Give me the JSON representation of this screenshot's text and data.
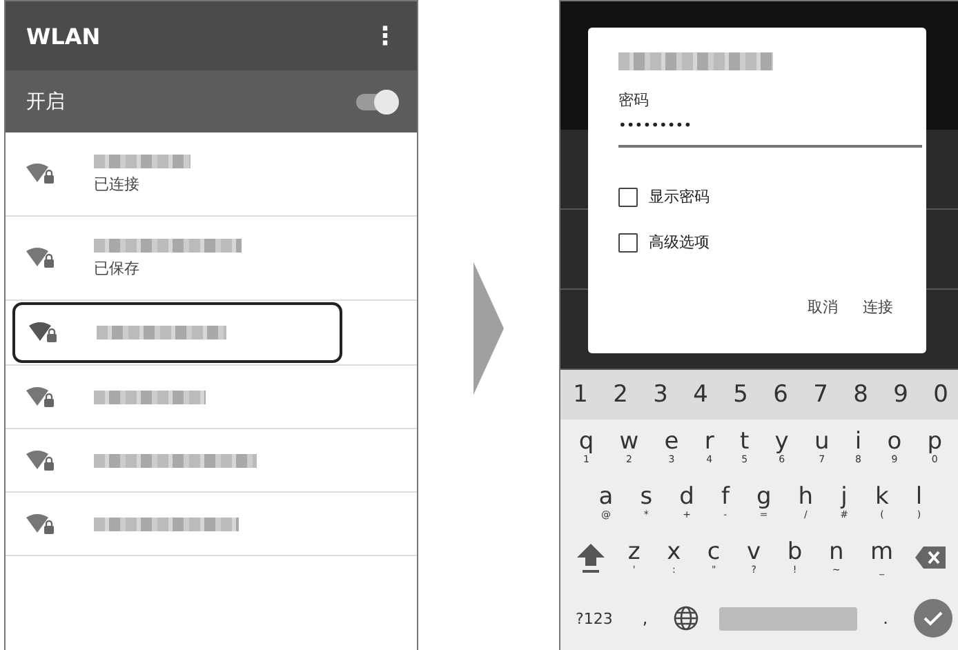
{
  "wlan_screen": {
    "title": "WLAN",
    "menu_icon": "⋮",
    "toggle": {
      "label": "开启",
      "on": true
    },
    "networks": [
      {
        "status": "已连接",
        "selected": false
      },
      {
        "status": "已保存",
        "selected": false
      },
      {
        "selected": true
      },
      {
        "selected": false
      },
      {
        "selected": false
      },
      {
        "selected": false
      }
    ]
  },
  "password_dialog": {
    "field_label": "密码",
    "password_value": "•••••••••",
    "checkboxes": [
      {
        "label": "显示密码",
        "checked": false
      },
      {
        "label": "高级选项",
        "checked": false
      }
    ],
    "buttons": [
      "取消",
      "连接"
    ]
  },
  "keyboard": {
    "number_row": [
      "1",
      "2",
      "3",
      "4",
      "5",
      "6",
      "7",
      "8",
      "9",
      "0"
    ],
    "letter_rows": [
      [
        {
          "key": "q",
          "hint": "1"
        },
        {
          "key": "w",
          "hint": "2"
        },
        {
          "key": "e",
          "hint": "3"
        },
        {
          "key": "r",
          "hint": "4"
        },
        {
          "key": "t",
          "hint": "5"
        },
        {
          "key": "y",
          "hint": "6"
        },
        {
          "key": "u",
          "hint": "7"
        },
        {
          "key": "i",
          "hint": "8"
        },
        {
          "key": "o",
          "hint": "9"
        },
        {
          "key": "p",
          "hint": "0"
        }
      ],
      [
        {
          "key": "a",
          "hint": "@"
        },
        {
          "key": "s",
          "hint": "*"
        },
        {
          "key": "d",
          "hint": "+"
        },
        {
          "key": "f",
          "hint": "-"
        },
        {
          "key": "g",
          "hint": "="
        },
        {
          "key": "h",
          "hint": "/"
        },
        {
          "key": "j",
          "hint": "#"
        },
        {
          "key": "k",
          "hint": "("
        },
        {
          "key": "l",
          "hint": ")"
        }
      ],
      [
        {
          "key": "z",
          "hint": "'"
        },
        {
          "key": "x",
          "hint": ":"
        },
        {
          "key": "c",
          "hint": "\""
        },
        {
          "key": "v",
          "hint": "?"
        },
        {
          "key": "b",
          "hint": "!"
        },
        {
          "key": "n",
          "hint": "~"
        },
        {
          "key": "m",
          "hint": "_"
        }
      ]
    ],
    "bottom_row": {
      "symbols_key": "?123",
      "comma_key": ",",
      "period_key": "."
    }
  }
}
